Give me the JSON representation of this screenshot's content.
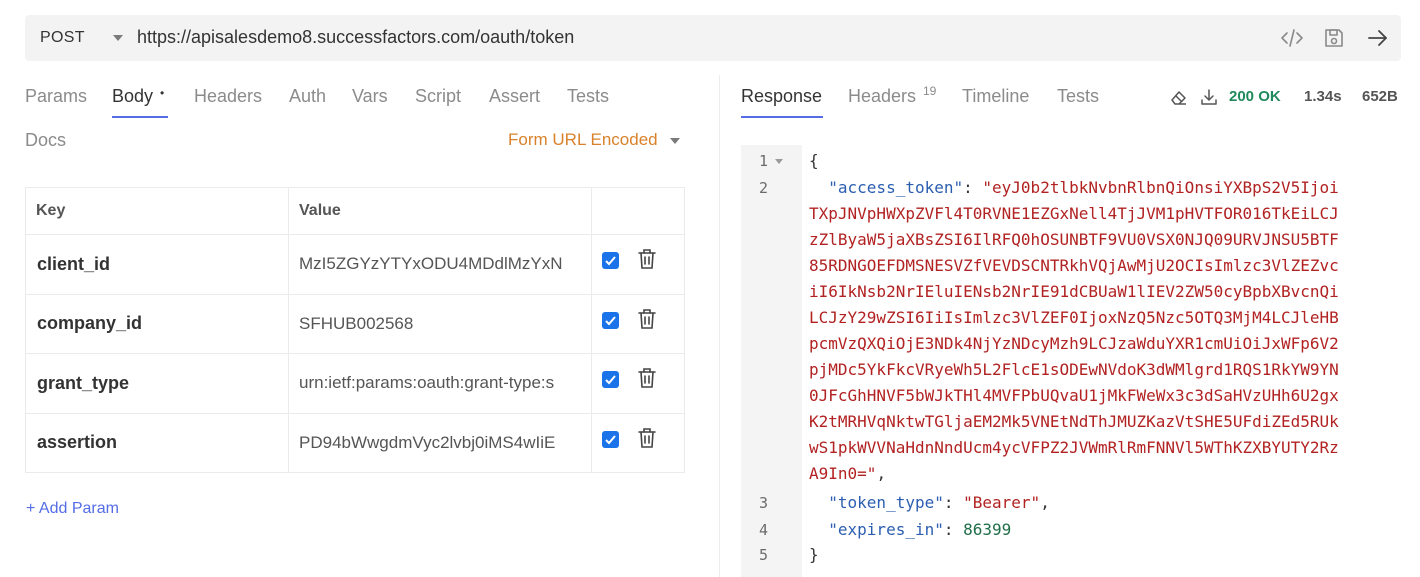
{
  "request": {
    "method": "POST",
    "url": "https://apisalesdemo8.successfactors.com/oauth/token"
  },
  "request_tabs": [
    {
      "label": "Params"
    },
    {
      "label": "Body",
      "modified_marker": "•"
    },
    {
      "label": "Headers"
    },
    {
      "label": "Auth"
    },
    {
      "label": "Vars"
    },
    {
      "label": "Script"
    },
    {
      "label": "Assert"
    },
    {
      "label": "Tests"
    },
    {
      "label": "Docs"
    }
  ],
  "body_mode": "Form URL Encoded",
  "params_table": {
    "columns": [
      "Key",
      "Value"
    ],
    "rows": [
      {
        "key": "client_id",
        "value": "MzI5ZGYzYTYxODU4MDdlMzYxN"
      },
      {
        "key": "company_id",
        "value": "SFHUB002568"
      },
      {
        "key": "grant_type",
        "value": "urn:ietf:params:oauth:grant-type:s"
      },
      {
        "key": "assertion",
        "value": "PD94bWwgdmVyc2lvbj0iMS4wIiE"
      }
    ]
  },
  "add_param_label": "+ Add Param",
  "response_tabs": [
    {
      "label": "Response"
    },
    {
      "label": "Headers",
      "count": "19"
    },
    {
      "label": "Timeline"
    },
    {
      "label": "Tests"
    }
  ],
  "response_status": {
    "code": "200 OK",
    "time": "1.34s",
    "size": "652B"
  },
  "response_body": {
    "line_numbers": [
      "1",
      "2",
      "3",
      "4",
      "5"
    ],
    "open_brace": "{",
    "close_brace": "}",
    "access_token_key": "\"access_token\"",
    "access_token_lines": [
      "\"eyJ0b2tlbkNvbnRlbnQiOnsiYXBpS2V5Ijoi",
      "TXpJNVpHWXpZVFl4T0RVNE1EZGxNell4TjJVM1pHVTFOR016TkEiLCJ",
      "zZlByaW5jaXBsZSI6IlRFQ0hOSUNBTF9VU0VSX0NJQ09URVJNSU5BTF",
      "85RDNGOEFDMSNESVZfVEVDSCNTRkhVQjAwMjU2OCIsImlzc3VlZEZvc",
      "iI6IkNsb2NrIEluIENsb2NrIE91dCBUaW1lIEV2ZW50cyBpbXBvcnQi",
      "LCJzY29wZSI6IiIsImlzc3VlZEF0IjoxNzQ5Nzc5OTQ3MjM4LCJleHB",
      "pcmVzQXQiOjE3NDk4NjYzNDcyMzh9LCJzaWduYXR1cmUiOiJxWFp6V2",
      "pjMDc5YkFkcVRyeWh5L2FlcE1sODEwNVdoK3dWMlgrd1RQS1RkYW9YN",
      "0JFcGhHNVF5bWJkTHl4MVFPbUQvaU1jMkFWeWx3c3dSaHVzUHh6U2gx",
      "K2tMRHVqNktwTGljaEM2Mk5VNEtNdThJMUZKazVtSHE5UFdiZEd5RUk",
      "wS1pkWVVNaHdnNndUcm4ycVFPZ2JVWmRlRmFNNVl5WThKZXBYUTY2Rz",
      "A9In0=\""
    ],
    "token_type_key": "\"token_type\"",
    "token_type_value": "\"Bearer\"",
    "expires_in_key": "\"expires_in\"",
    "expires_in_value": "86399"
  },
  "colors": {
    "accent": "#546de5",
    "status_ok": "#1f8a5b",
    "form_mode": "#d9822b",
    "json_key": "#2b5eb0",
    "json_string": "#b22222",
    "json_number": "#1f6f4a"
  }
}
